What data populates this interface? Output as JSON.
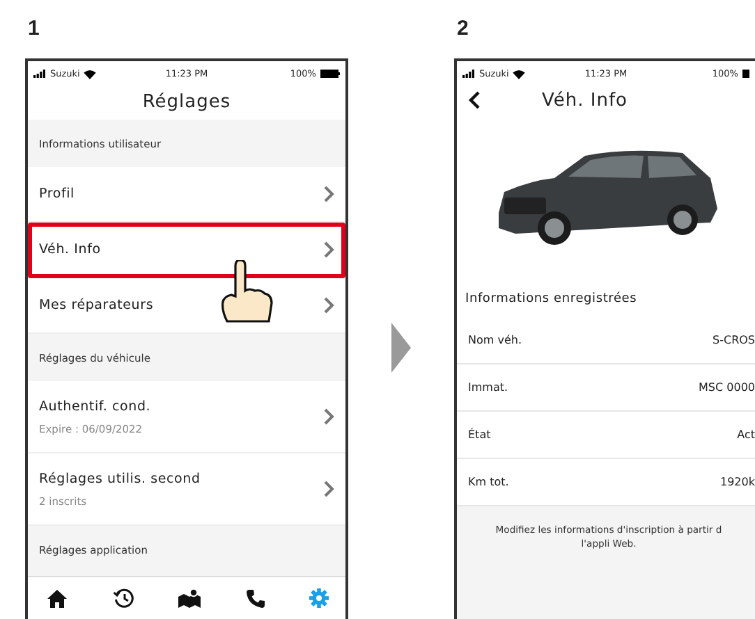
{
  "step_labels": [
    "1",
    "2"
  ],
  "settings_screen": {
    "status": {
      "carrier": "Suzuki",
      "time": "11:23 PM",
      "battery": "100%"
    },
    "title": "Réglages",
    "items": [
      {
        "kind": "section",
        "label": "Informations utilisateur"
      },
      {
        "kind": "link",
        "label": "Profil",
        "highlighted": false
      },
      {
        "kind": "link",
        "label": "Véh. Info",
        "highlighted": true
      },
      {
        "kind": "link",
        "label": "Mes réparateurs",
        "highlighted": false
      },
      {
        "kind": "section",
        "label": "Réglages du véhicule"
      },
      {
        "kind": "link",
        "label": "Authentif. cond.",
        "sub": "Expire : 06/09/2022",
        "highlighted": false
      },
      {
        "kind": "link",
        "label": "Réglages utilis. second",
        "sub": "2 inscrits",
        "highlighted": false
      },
      {
        "kind": "section",
        "label": "Réglages application"
      }
    ],
    "tabs": [
      {
        "selected": false
      },
      {
        "selected": false
      },
      {
        "selected": false
      },
      {
        "selected": false
      },
      {
        "selected": true
      }
    ]
  },
  "info_screen": {
    "status": {
      "carrier": "Suzuki",
      "time": "11:23 PM",
      "battery": "100%"
    },
    "title": "Véh. Info",
    "section": "Informations enregistrées",
    "rows": [
      {
        "label": "Nom véh.",
        "value": "S-CROS"
      },
      {
        "label": "Immat.",
        "value": "MSC 0000"
      },
      {
        "label": "État",
        "value": "Act"
      },
      {
        "label": "Km tot.",
        "value": "1920k"
      }
    ],
    "note": "Modifiez les informations d'inscription à partir d l'appli Web."
  }
}
